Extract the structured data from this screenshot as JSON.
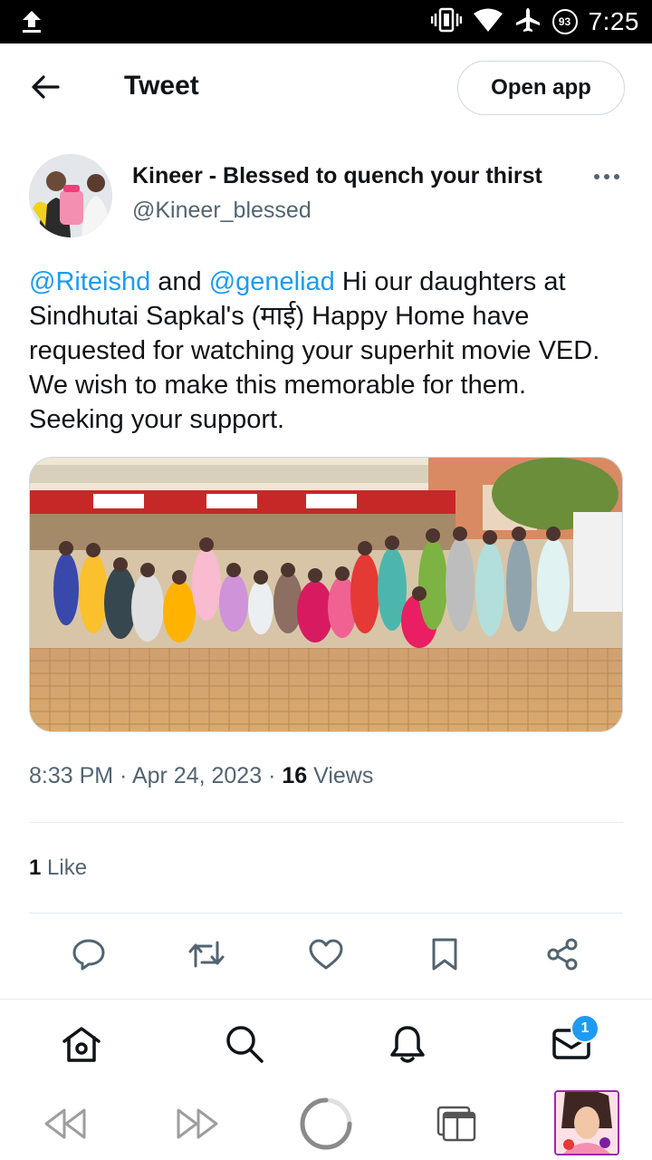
{
  "status_bar": {
    "time": "7:25",
    "battery": "93",
    "icons": [
      "upload-icon",
      "vibrate-icon",
      "wifi-icon",
      "airplane-icon",
      "battery-icon"
    ]
  },
  "header": {
    "title": "Tweet",
    "open_app_label": "Open app",
    "back_icon": "arrow-left-icon"
  },
  "tweet": {
    "display_name": "Kineer - Blessed to quench your thirst",
    "handle": "@Kineer_blessed",
    "mention_1": "@Riteishd",
    "connector": " and ",
    "mention_2": "@geneliad",
    "body": "  Hi our daughters at Sindhutai Sapkal's (माई) Happy Home have requested for watching your superhit movie VED. We wish to make this memorable for them. Seeking your support.",
    "time": "8:33 PM",
    "separator": " · ",
    "date": "Apr 24, 2023",
    "separator_2": " · ",
    "views_count": "16",
    "views_label": " Views",
    "likes_count": "1",
    "likes_label": " Like"
  },
  "actions": [
    "reply-icon",
    "retweet-icon",
    "like-icon",
    "bookmark-icon",
    "share-icon"
  ],
  "bottom_nav": {
    "items": [
      "home-icon",
      "search-icon",
      "notifications-icon",
      "messages-icon"
    ],
    "messages_badge": "1"
  },
  "browser_toolbar": {
    "items": [
      "rewind-icon",
      "fast-forward-icon",
      "loading-icon",
      "tabs-icon",
      "profile-avatar"
    ]
  },
  "colors": {
    "accent": "#1d9bf0",
    "text": "#0f1419",
    "secondary": "#536471",
    "border": "#cfd9de"
  }
}
